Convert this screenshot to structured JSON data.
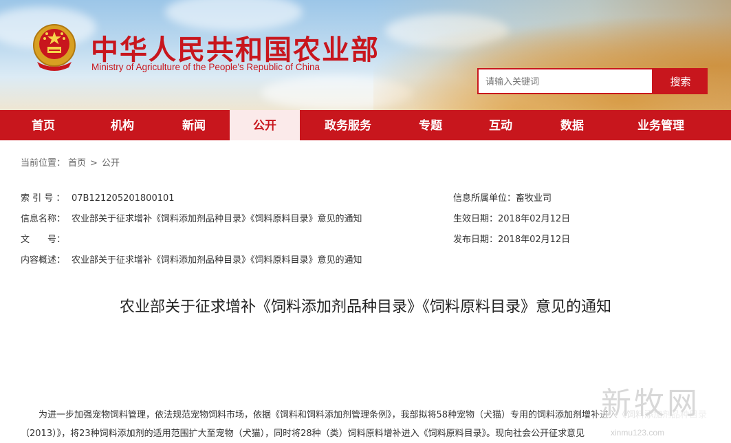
{
  "header": {
    "title_cn": "中华人民共和国农业部",
    "title_en": "Ministry of Agriculture of the People's Republic of China",
    "emblem_icon": "national-emblem-icon",
    "search": {
      "placeholder": "请输入关键词",
      "button": "搜索"
    }
  },
  "nav": {
    "items": [
      {
        "label": "首页"
      },
      {
        "label": "机构"
      },
      {
        "label": "新闻"
      },
      {
        "label": "公开",
        "active": true
      },
      {
        "label": "政务服务"
      },
      {
        "label": "专题"
      },
      {
        "label": "互动"
      },
      {
        "label": "数据"
      },
      {
        "label": "业务管理"
      }
    ]
  },
  "breadcrumb": {
    "prefix": "当前位置：",
    "home": "首页",
    "sep": ">",
    "current": "公开"
  },
  "meta": {
    "index_label": "索 引 号 ：",
    "index_value": "07B121205201800101",
    "name_label": "信息名称：",
    "name_value": "农业部关于征求增补《饲料添加剂品种目录》《饲料原料目录》意见的通知",
    "doc_label": "文　　号：",
    "doc_value": "",
    "summary_label": "内容概述：",
    "summary_value": "农业部关于征求增补《饲料添加剂品种目录》《饲料原料目录》意见的通知",
    "unit_label": "信息所属单位：",
    "unit_value": "畜牧业司",
    "effective_label": "生效日期：",
    "effective_value": "2018年02月12日",
    "publish_label": "发布日期：",
    "publish_value": "2018年02月12日"
  },
  "article": {
    "title": "农业部关于征求增补《饲料添加剂品种目录》《饲料原料目录》意见的通知",
    "paragraph": "为进一步加强宠物饲料管理，依法规范宠物饲料市场，依据《饲料和饲料添加剂管理条例》，我部拟将58种宠物（犬猫）专用的饲料添加剂增补进入《饲料添加剂品种目录（2013）》，将23种饲料添加剂的适用范围扩大至宠物（犬猫），同时将28种（类）饲料原料增补进入《饲料原料目录》。现向社会公开征求意见"
  },
  "watermark": {
    "text": "新牧网",
    "sub": "xinmu123.com"
  },
  "colors": {
    "brand_red": "#c8161d",
    "active_tab_bg": "#fbeaea"
  }
}
